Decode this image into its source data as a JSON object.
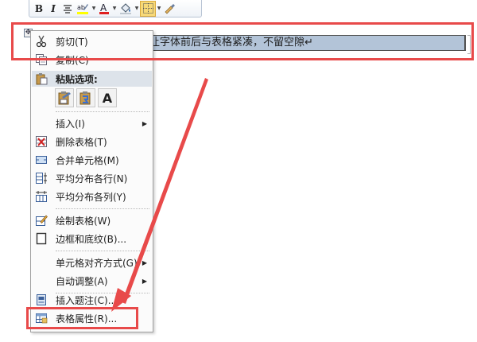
{
  "mini_toolbar": {
    "bold": "B",
    "italic": "I",
    "align_icon": "align-center-icon",
    "highlight_icon": "highlight-pen-icon",
    "highlight_color": "#ffff00",
    "font_color_letter": "A",
    "font_color": "#e02020",
    "shading_icon": "paint-bucket-icon",
    "borders_icon": "borders-icon",
    "format_painter_icon": "format-painter-icon"
  },
  "document": {
    "cell_text": "让字体前后与表格紧凑，不留空隙↵"
  },
  "context_menu": {
    "cut": {
      "label": "剪切(T)",
      "icon": "scissors-icon"
    },
    "copy": {
      "label": "复制(C)",
      "icon": "copy-icon"
    },
    "paste_options_header": {
      "label": "粘贴选项:",
      "icon": "paste-icon"
    },
    "paste_options": [
      {
        "icon": "paste-keep-formatting-icon"
      },
      {
        "icon": "paste-merge-formatting-icon"
      },
      {
        "icon": "paste-text-only-icon",
        "letter": "A"
      }
    ],
    "insert": {
      "label": "插入(I)"
    },
    "delete_table": {
      "label": "删除表格(T)",
      "icon": "delete-table-icon"
    },
    "merge_cells": {
      "label": "合并单元格(M)",
      "icon": "merge-cells-icon"
    },
    "distribute_rows": {
      "label": "平均分布各行(N)",
      "icon": "distribute-rows-icon"
    },
    "distribute_columns": {
      "label": "平均分布各列(Y)",
      "icon": "distribute-columns-icon"
    },
    "draw_table": {
      "label": "绘制表格(W)",
      "icon": "draw-table-icon"
    },
    "borders_shading": {
      "label": "边框和底纹(B)...",
      "icon": "borders-shading-icon"
    },
    "cell_alignment": {
      "label": "单元格对齐方式(G)"
    },
    "autofit": {
      "label": "自动调整(A)"
    },
    "insert_caption": {
      "label": "插入题注(C)...",
      "icon": "caption-icon"
    },
    "table_properties": {
      "label": "表格属性(R)...",
      "icon": "table-properties-icon"
    }
  },
  "annotations": {
    "highlight_color": "#e84a4a"
  }
}
